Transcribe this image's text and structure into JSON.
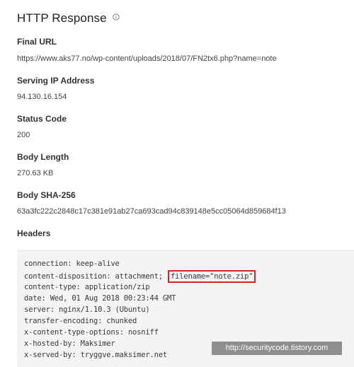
{
  "title": "HTTP Response",
  "info_icon": "info-circle-icon",
  "fields": {
    "final_url": {
      "label": "Final URL",
      "value": "https://www.aks77.no/wp-content/uploads/2018/07/FN2tx6.php?name=note"
    },
    "serving_ip": {
      "label": "Serving IP Address",
      "value": "94.130.16.154"
    },
    "status_code": {
      "label": "Status Code",
      "value": "200"
    },
    "body_length": {
      "label": "Body Length",
      "value": "270.63 KB"
    },
    "body_sha256": {
      "label": "Body SHA-256",
      "value": "63a3fc222c2848c17c381e91ab27ca693cad94c839148e5cc05064d859684f13"
    },
    "headers": {
      "label": "Headers"
    }
  },
  "header_lines": {
    "connection": "connection: keep-alive",
    "content_disposition_prefix": "content-disposition: attachment; ",
    "content_disposition_filename": "filename=\"note.zip\"",
    "content_type": "content-type: application/zip",
    "date": "date: Wed, 01 Aug 2018 00:23:44 GMT",
    "server": "server: nginx/1.10.3 (Ubuntu)",
    "transfer_encoding": "transfer-encoding: chunked",
    "x_content_type_options": "x-content-type-options: nosniff",
    "x_hosted_by": "x-hosted-by: Maksimer",
    "x_served_by": "x-served-by: tryggve.maksimer.net"
  },
  "watermark": "http://securitycode.tistory.com",
  "colors": {
    "highlight_border": "#e02020",
    "headers_background": "#f3f4f5"
  }
}
